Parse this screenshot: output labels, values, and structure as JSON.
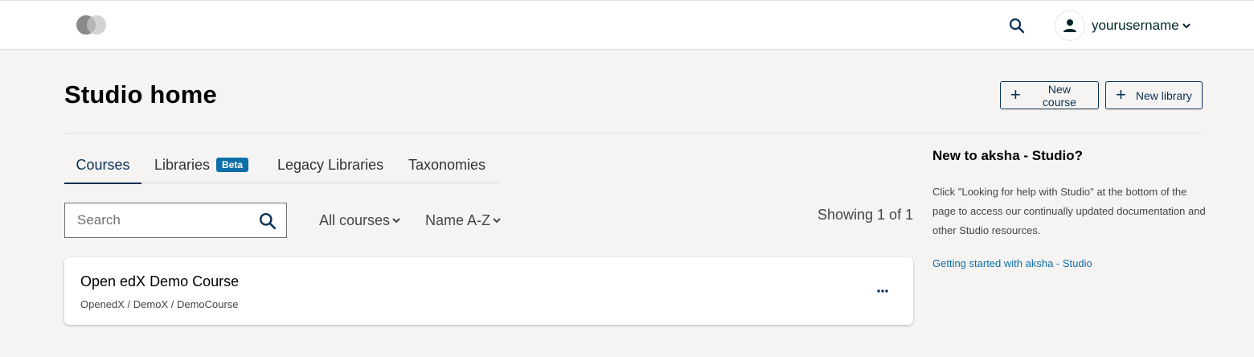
{
  "header": {
    "logo_icon": "toggle-logo-icon",
    "search_icon": "search-icon",
    "user": {
      "avatar_icon": "person-icon",
      "username": "yourusername",
      "caret_icon": "chevron-down-icon"
    }
  },
  "page": {
    "title": "Studio home",
    "actions": {
      "new_course": "New course",
      "new_library": "New library"
    }
  },
  "tabs": [
    {
      "label": "Courses",
      "active": true
    },
    {
      "label": "Libraries",
      "badge": "Beta",
      "active": false
    },
    {
      "label": "Legacy Libraries",
      "active": false
    },
    {
      "label": "Taxonomies",
      "active": false
    }
  ],
  "filters": {
    "search_placeholder": "Search",
    "search_value": "",
    "course_filter": "All courses",
    "sort": "Name A-Z",
    "showing": "Showing 1 of 1"
  },
  "courses": [
    {
      "title": "Open edX Demo Course",
      "meta": "OpenedX / DemoX / DemoCourse",
      "menu_icon": "more-horizontal-icon"
    }
  ],
  "sidebar": {
    "title": "New to aksha - Studio?",
    "text": "Click \"Looking for help with Studio\" at the bottom of the page to access our continually updated documentation and other Studio resources.",
    "link": "Getting started with aksha - Studio"
  },
  "colors": {
    "background": "#f5f4f2",
    "primary": "#0a3055",
    "beta_badge": "#0d6fa8",
    "link": "#0d6fa8"
  }
}
